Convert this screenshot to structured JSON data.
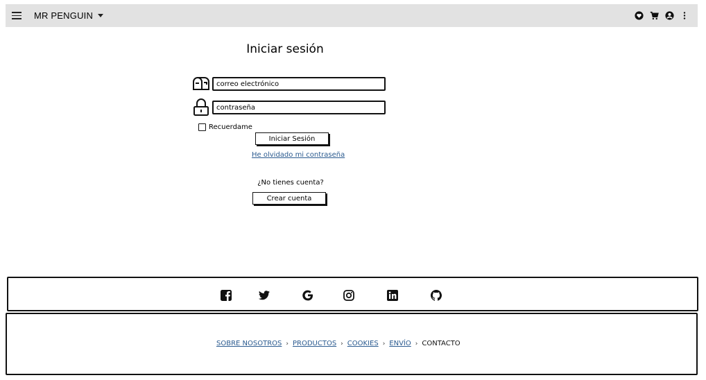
{
  "header": {
    "brand": "MR PENGUIN",
    "icons": [
      "menu-icon",
      "heart-icon",
      "cart-icon",
      "user-icon",
      "more-vertical-icon"
    ]
  },
  "login": {
    "title": "Iniciar sesión",
    "email_placeholder": "correo electrónico",
    "password_placeholder": "contraseña",
    "remember_label": "Recuerdame",
    "submit_label": "Iniciar Sesión",
    "forgot_label": "He olvidado mi contraseña",
    "no_account_text": "¿No tienes cuenta?",
    "create_label": "Crear cuenta"
  },
  "social": {
    "icons": [
      "facebook-icon",
      "twitter-icon",
      "google-icon",
      "instagram-icon",
      "linkedin-icon",
      "github-icon"
    ]
  },
  "footer": {
    "links": [
      "SOBRE NOSOTROS",
      "PRODUCTOS",
      "COOKIES",
      "ENVÍO"
    ],
    "current": "CONTACTO",
    "separator": "›"
  }
}
